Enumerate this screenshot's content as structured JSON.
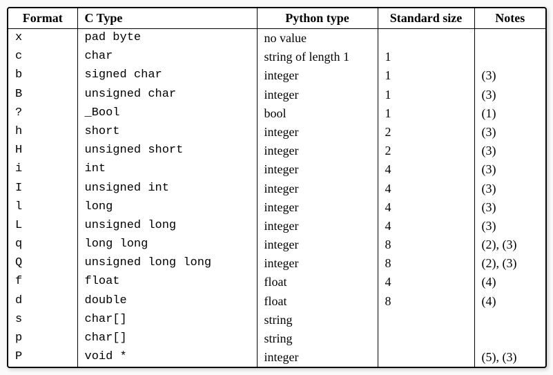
{
  "table": {
    "headers": {
      "format": "Format",
      "ctype": "C Type",
      "pytype": "Python type",
      "size": "Standard size",
      "notes": "Notes"
    },
    "rows": [
      {
        "format": "x",
        "ctype": "pad byte",
        "pytype": "no value",
        "size": "",
        "notes": ""
      },
      {
        "format": "c",
        "ctype": "char",
        "pytype": "string of length 1",
        "size": "1",
        "notes": ""
      },
      {
        "format": "b",
        "ctype": "signed char",
        "pytype": "integer",
        "size": "1",
        "notes": "(3)"
      },
      {
        "format": "B",
        "ctype": "unsigned char",
        "pytype": "integer",
        "size": "1",
        "notes": "(3)"
      },
      {
        "format": "?",
        "ctype": "_Bool",
        "pytype": "bool",
        "size": "1",
        "notes": "(1)"
      },
      {
        "format": "h",
        "ctype": "short",
        "pytype": "integer",
        "size": "2",
        "notes": "(3)"
      },
      {
        "format": "H",
        "ctype": "unsigned short",
        "pytype": "integer",
        "size": "2",
        "notes": "(3)"
      },
      {
        "format": "i",
        "ctype": "int",
        "pytype": "integer",
        "size": "4",
        "notes": "(3)"
      },
      {
        "format": "I",
        "ctype": "unsigned int",
        "pytype": "integer",
        "size": "4",
        "notes": "(3)"
      },
      {
        "format": "l",
        "ctype": "long",
        "pytype": "integer",
        "size": "4",
        "notes": "(3)"
      },
      {
        "format": "L",
        "ctype": "unsigned long",
        "pytype": "integer",
        "size": "4",
        "notes": "(3)"
      },
      {
        "format": "q",
        "ctype": "long long",
        "pytype": "integer",
        "size": "8",
        "notes": "(2), (3)"
      },
      {
        "format": "Q",
        "ctype": "unsigned long long",
        "pytype": "integer",
        "size": "8",
        "notes": "(2), (3)"
      },
      {
        "format": "f",
        "ctype": "float",
        "pytype": "float",
        "size": "4",
        "notes": "(4)"
      },
      {
        "format": "d",
        "ctype": "double",
        "pytype": "float",
        "size": "8",
        "notes": "(4)"
      },
      {
        "format": "s",
        "ctype": "char[]",
        "pytype": "string",
        "size": "",
        "notes": ""
      },
      {
        "format": "p",
        "ctype": "char[]",
        "pytype": "string",
        "size": "",
        "notes": ""
      },
      {
        "format": "P",
        "ctype": "void *",
        "pytype": "integer",
        "size": "",
        "notes": "(5), (3)"
      }
    ]
  }
}
